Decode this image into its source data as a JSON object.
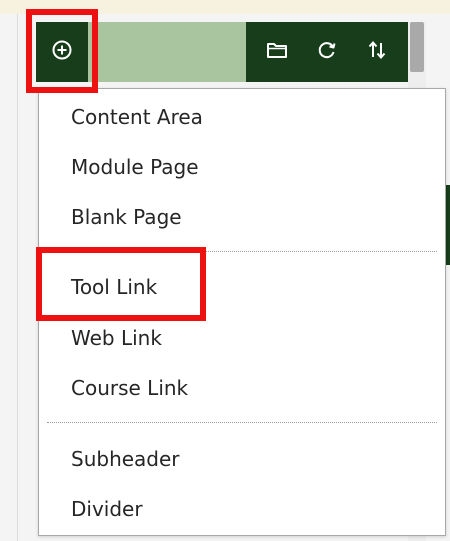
{
  "toolbar": {
    "add_icon": "plus-circle-icon",
    "folder_icon": "folder-icon",
    "refresh_icon": "refresh-icon",
    "sort_icon": "sort-arrows-icon"
  },
  "menu": {
    "items": [
      {
        "label": "Content Area"
      },
      {
        "label": "Module Page"
      },
      {
        "label": "Blank Page"
      },
      {
        "label": "Tool Link"
      },
      {
        "label": "Web Link"
      },
      {
        "label": "Course Link"
      },
      {
        "label": "Subheader"
      },
      {
        "label": "Divider"
      }
    ]
  },
  "colors": {
    "toolbar_dark": "#173d1a",
    "toolbar_light": "#a9c5a0",
    "highlight": "#ee1111"
  }
}
